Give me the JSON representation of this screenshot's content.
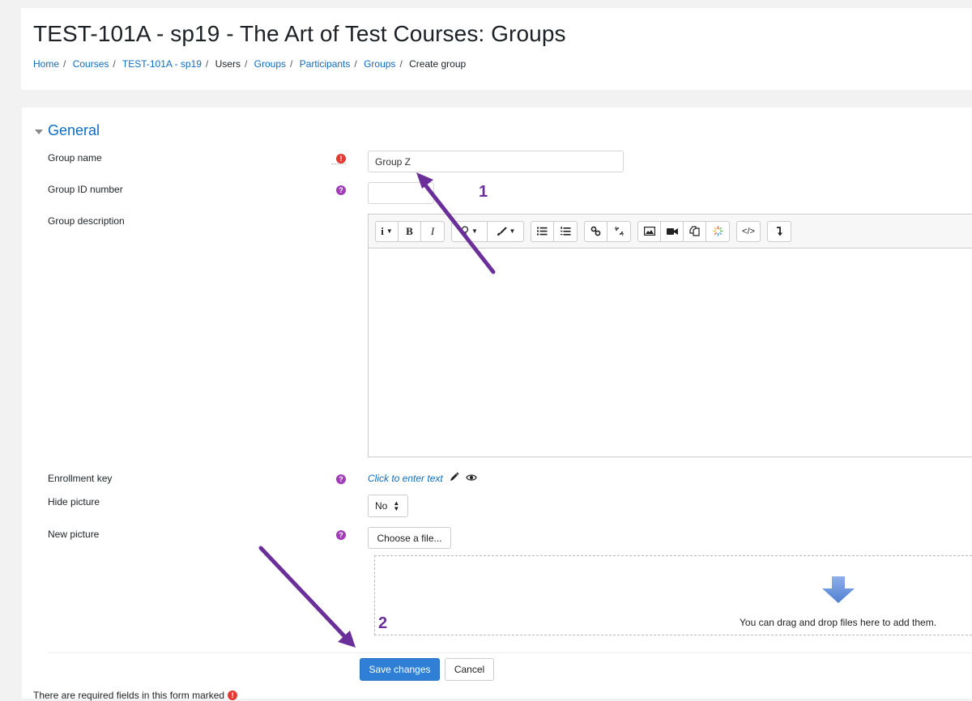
{
  "header": {
    "title": "TEST-101A - sp19 - The Art of Test Courses: Groups",
    "breadcrumb": [
      {
        "label": "Home",
        "link": true
      },
      {
        "label": "Courses",
        "link": true
      },
      {
        "label": "TEST-101A - sp19",
        "link": true
      },
      {
        "label": "Users",
        "link": false
      },
      {
        "label": "Groups",
        "link": true
      },
      {
        "label": "Participants",
        "link": true
      },
      {
        "label": "Groups",
        "link": true
      },
      {
        "label": "Create group",
        "link": false
      }
    ]
  },
  "form": {
    "section_title": "General",
    "fields": {
      "group_name": {
        "label": "Group name",
        "value": "Group Z",
        "required_icon": "!"
      },
      "group_id": {
        "label": "Group ID number",
        "value": "",
        "help_icon": "?"
      },
      "group_description": {
        "label": "Group description",
        "value": ""
      },
      "enrollment_key": {
        "label": "Enrollment key",
        "inplace_text": "Click to enter text",
        "help_icon": "?"
      },
      "hide_picture": {
        "label": "Hide picture",
        "selected": "No"
      },
      "new_picture": {
        "label": "New picture",
        "choose_label": "Choose a file...",
        "help_icon": "?",
        "drop_text": "You can drag and drop files here to add them."
      }
    },
    "toolbar": [
      [
        {
          "name": "info",
          "glyph": "i",
          "dropdown": true
        },
        {
          "name": "bold",
          "glyph": "B"
        },
        {
          "name": "italic",
          "glyph": "I"
        }
      ],
      [
        {
          "name": "lightbulb",
          "glyph": "💡",
          "dropdown": true
        },
        {
          "name": "brush",
          "glyph": "🖌",
          "dropdown": true
        }
      ],
      [
        {
          "name": "unordered-list",
          "glyph": "☰"
        },
        {
          "name": "ordered-list",
          "glyph": "☷"
        }
      ],
      [
        {
          "name": "link",
          "glyph": "🔗"
        },
        {
          "name": "unlink",
          "glyph": "⛓"
        }
      ],
      [
        {
          "name": "image",
          "glyph": "🖼"
        },
        {
          "name": "video",
          "glyph": "■"
        },
        {
          "name": "manage-files",
          "glyph": "❐"
        },
        {
          "name": "media",
          "glyph": "✳"
        }
      ],
      [
        {
          "name": "html",
          "glyph": "</>"
        }
      ],
      [
        {
          "name": "expand",
          "glyph": "↴"
        }
      ]
    ],
    "save_label": "Save changes",
    "cancel_label": "Cancel",
    "required_note": "There are required fields in this form marked"
  },
  "annotations": [
    {
      "label": "1",
      "color": "#6a2f99"
    },
    {
      "label": "2",
      "color": "#6a2f99"
    }
  ],
  "colors": {
    "link": "#0f6cbf",
    "primary_button": "#2f7fd6",
    "required": "#e53935",
    "help": "#a23bb8",
    "annotation": "#6a2f99"
  }
}
